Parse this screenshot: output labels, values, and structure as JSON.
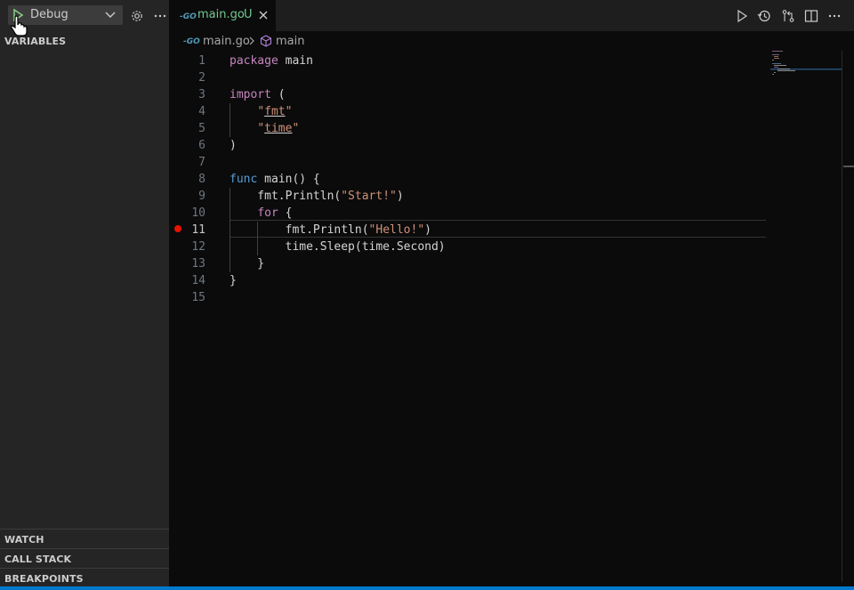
{
  "sidebar": {
    "config_label": "Debug",
    "sections": {
      "variables": "VARIABLES",
      "watch": "WATCH",
      "call_stack": "CALL STACK",
      "breakpoints": "BREAKPOINTS"
    }
  },
  "tab": {
    "icon_text": "-GO",
    "label": "main.go",
    "status": "U"
  },
  "breadcrumb": {
    "icon_text": "-GO",
    "file": "main.go",
    "symbol": "main"
  },
  "editor": {
    "current_line": 11,
    "breakpoint_line": 11,
    "lines": [
      {
        "n": "1",
        "tokens": [
          {
            "t": "package",
            "c": "kw"
          },
          {
            "t": " main",
            "c": "plain"
          }
        ]
      },
      {
        "n": "2",
        "tokens": []
      },
      {
        "n": "3",
        "tokens": [
          {
            "t": "import",
            "c": "kw"
          },
          {
            "t": " (",
            "c": "plain"
          }
        ]
      },
      {
        "n": "4",
        "tokens": [
          {
            "t": "    ",
            "c": "plain"
          },
          {
            "t": "\"",
            "c": "str"
          },
          {
            "t": "fmt",
            "c": "str ul"
          },
          {
            "t": "\"",
            "c": "str"
          }
        ]
      },
      {
        "n": "5",
        "tokens": [
          {
            "t": "    ",
            "c": "plain"
          },
          {
            "t": "\"",
            "c": "str"
          },
          {
            "t": "time",
            "c": "str ul"
          },
          {
            "t": "\"",
            "c": "str"
          }
        ]
      },
      {
        "n": "6",
        "tokens": [
          {
            "t": ")",
            "c": "plain"
          }
        ]
      },
      {
        "n": "7",
        "tokens": []
      },
      {
        "n": "8",
        "tokens": [
          {
            "t": "func",
            "c": "kw2"
          },
          {
            "t": " main() {",
            "c": "plain"
          }
        ]
      },
      {
        "n": "9",
        "tokens": [
          {
            "t": "    fmt.Println(",
            "c": "plain"
          },
          {
            "t": "\"Start!\"",
            "c": "str"
          },
          {
            "t": ")",
            "c": "plain"
          }
        ]
      },
      {
        "n": "10",
        "tokens": [
          {
            "t": "    ",
            "c": "plain"
          },
          {
            "t": "for",
            "c": "kw"
          },
          {
            "t": " {",
            "c": "plain"
          }
        ]
      },
      {
        "n": "11",
        "tokens": [
          {
            "t": "        fmt.Println(",
            "c": "plain"
          },
          {
            "t": "\"Hello!\"",
            "c": "str"
          },
          {
            "t": ")",
            "c": "plain"
          }
        ]
      },
      {
        "n": "12",
        "tokens": [
          {
            "t": "        time.Sleep(time.Second)",
            "c": "plain"
          }
        ]
      },
      {
        "n": "13",
        "tokens": [
          {
            "t": "    }",
            "c": "plain"
          }
        ]
      },
      {
        "n": "14",
        "tokens": [
          {
            "t": "}",
            "c": "plain"
          }
        ]
      },
      {
        "n": "15",
        "tokens": []
      }
    ]
  },
  "colors": {
    "accent": "#007acc",
    "tab_modified": "#73c991",
    "breakpoint": "#e51400",
    "keyword": "#c586c0",
    "string": "#ce9178"
  }
}
